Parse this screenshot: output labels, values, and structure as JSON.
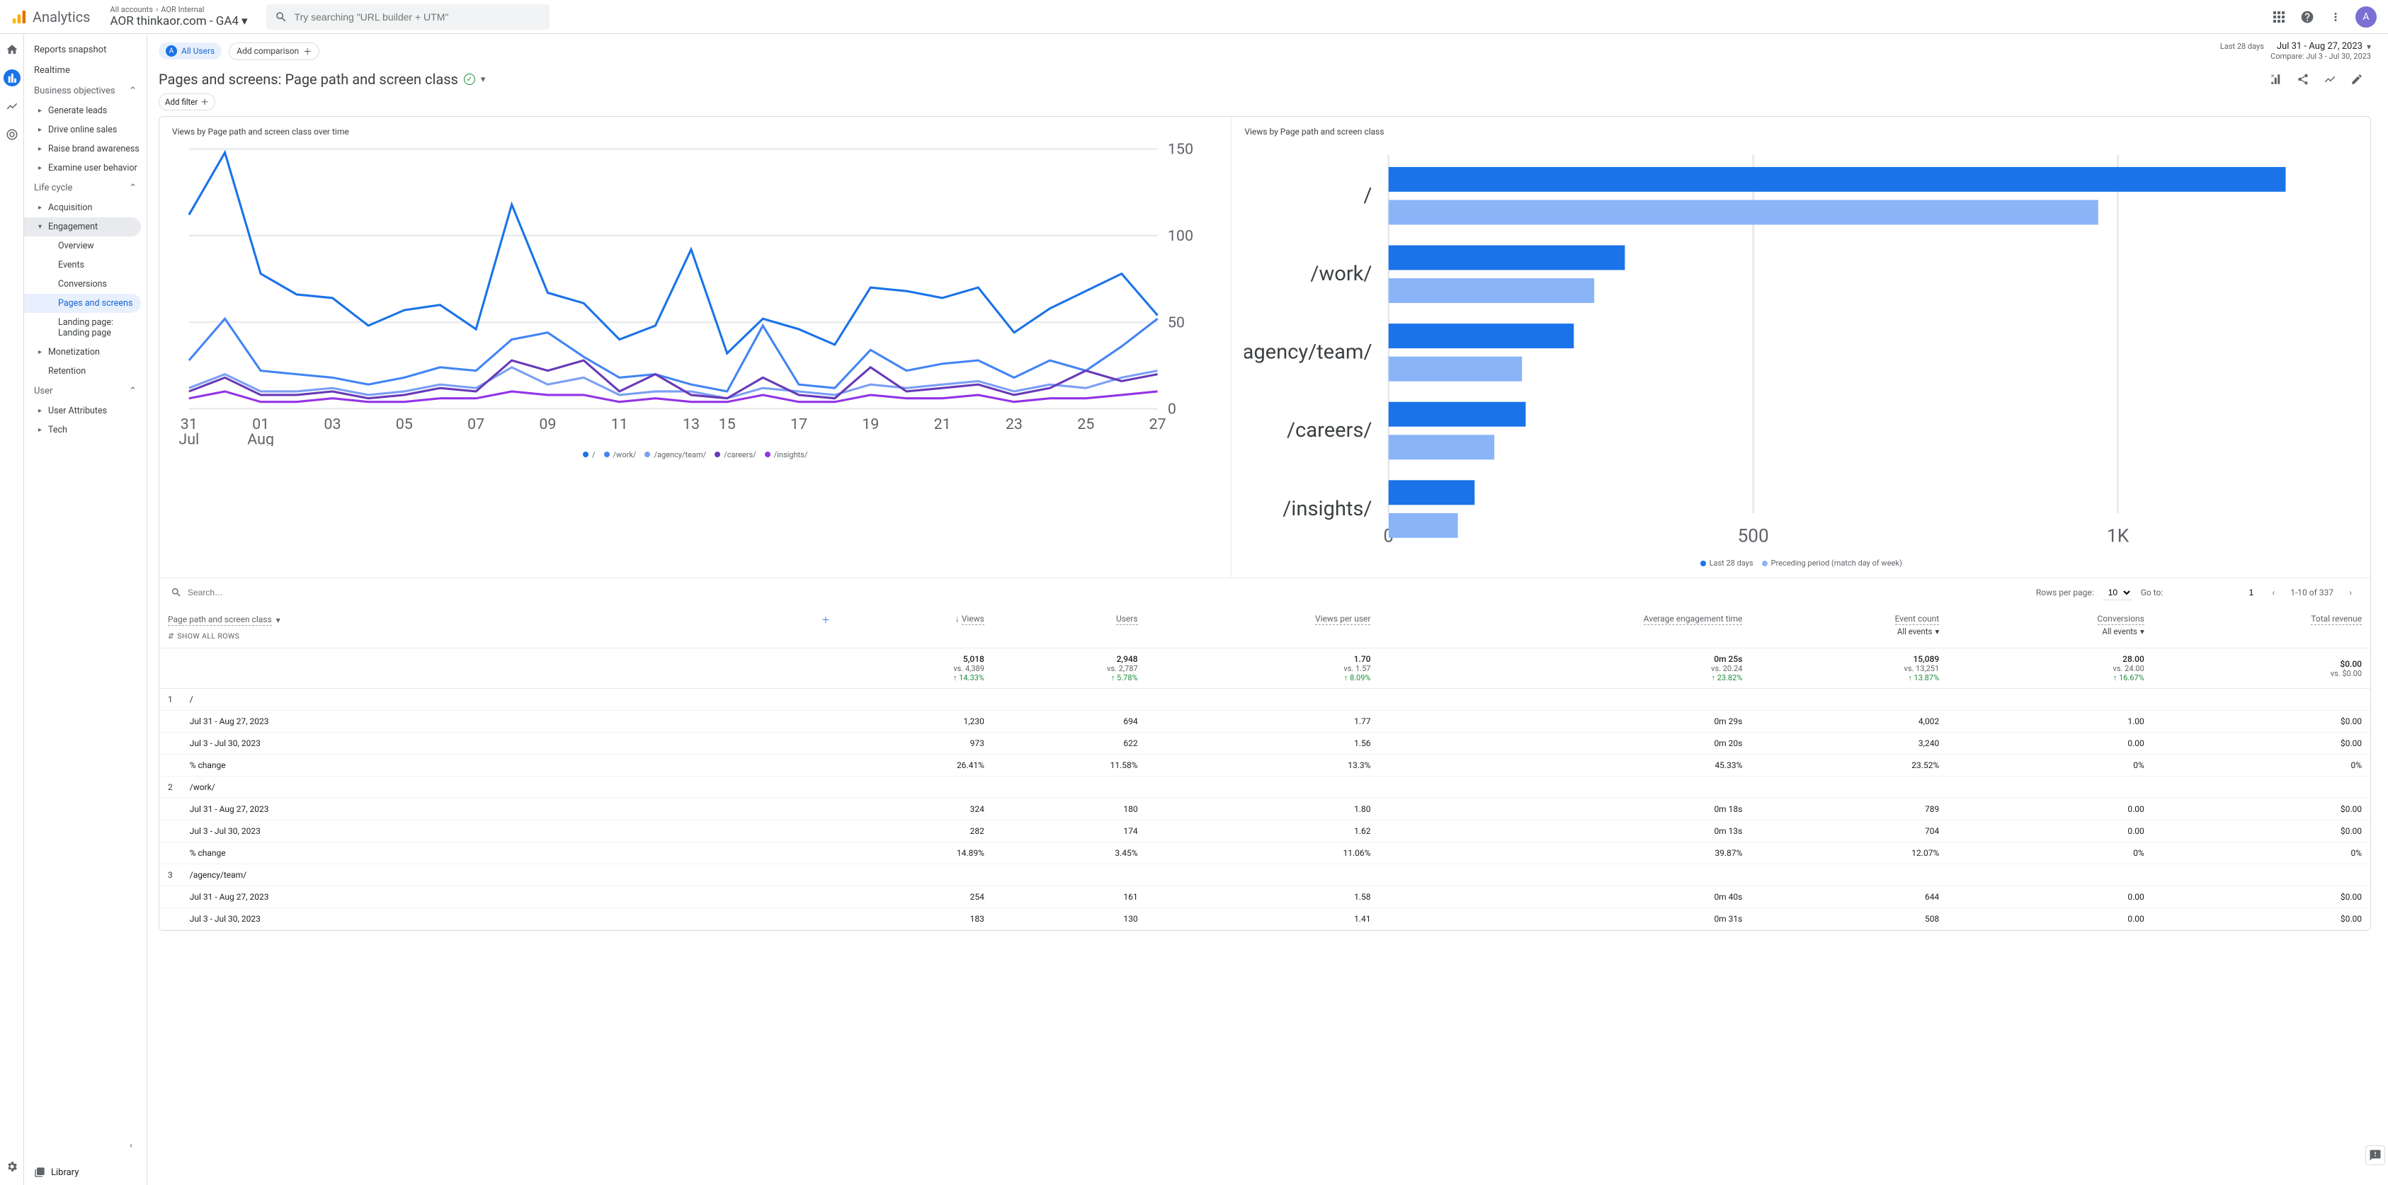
{
  "brand": "Analytics",
  "breadcrumb": {
    "accounts": "All accounts",
    "internal": "AOR Internal",
    "property": "AOR thinkaor.com - GA4"
  },
  "search_placeholder": "Try searching \"URL builder + UTM\"",
  "avatar_letter": "A",
  "sidebar": {
    "reports_snapshot": "Reports snapshot",
    "realtime": "Realtime",
    "business_objectives": "Business objectives",
    "generate_leads": "Generate leads",
    "drive_online_sales": "Drive online sales",
    "raise_brand_awareness": "Raise brand awareness",
    "examine_user_behavior": "Examine user behavior",
    "life_cycle": "Life cycle",
    "acquisition": "Acquisition",
    "engagement": "Engagement",
    "overview": "Overview",
    "events": "Events",
    "conversions": "Conversions",
    "pages_and_screens": "Pages and screens",
    "landing_page": "Landing page: Landing page",
    "monetization": "Monetization",
    "retention": "Retention",
    "user": "User",
    "user_attributes": "User Attributes",
    "tech": "Tech",
    "library": "Library"
  },
  "pills": {
    "all_users": "All Users",
    "add_comparison": "Add comparison"
  },
  "date": {
    "label": "Last 28 days",
    "range": "Jul 31 - Aug 27, 2023",
    "compare": "Compare: Jul 3 - Jul 30, 2023"
  },
  "page_title": "Pages and screens: Page path and screen class",
  "add_filter": "Add filter",
  "chart1_title": "Views by Page path and screen class over time",
  "chart2_title": "Views by Page path and screen class",
  "legend_pages": [
    "/",
    "/work/",
    "/agency/team/",
    "/careers/",
    "/insights/"
  ],
  "legend_colors": [
    "#1a73e8",
    "#4285f4",
    "#7b9ff5",
    "#673ab7",
    "#9334e6"
  ],
  "legend2_a": "Last 28 days",
  "legend2_b": "Preceding period (match day of week)",
  "bar_color_a": "#1a73e8",
  "bar_color_b": "#8ab4f8",
  "chart_data": {
    "line": {
      "type": "line",
      "x_ticks": [
        "31 Jul",
        "01 Aug",
        "03",
        "05",
        "07",
        "09",
        "11",
        "13",
        "15",
        "17",
        "19",
        "21",
        "23",
        "25",
        "27"
      ],
      "ylim": [
        0,
        150
      ],
      "yticks": [
        0,
        50,
        100,
        150
      ],
      "series": [
        {
          "name": "/",
          "color": "#1a73e8",
          "values": [
            112,
            148,
            78,
            66,
            64,
            48,
            57,
            60,
            46,
            118,
            67,
            61,
            40,
            48,
            92,
            32,
            52,
            46,
            37,
            70,
            68,
            64,
            70,
            44,
            58,
            68,
            78,
            54
          ]
        },
        {
          "name": "/work/",
          "color": "#4285f4",
          "values": [
            28,
            52,
            22,
            20,
            18,
            14,
            18,
            24,
            22,
            40,
            44,
            30,
            18,
            20,
            14,
            10,
            48,
            14,
            12,
            34,
            22,
            26,
            28,
            18,
            28,
            22,
            36,
            52
          ]
        },
        {
          "name": "/agency/team/",
          "color": "#7b9ff5",
          "values": [
            12,
            20,
            10,
            10,
            12,
            8,
            10,
            14,
            12,
            24,
            14,
            18,
            8,
            10,
            10,
            6,
            12,
            10,
            8,
            14,
            12,
            14,
            16,
            10,
            14,
            12,
            18,
            22
          ]
        },
        {
          "name": "/careers/",
          "color": "#673ab7",
          "values": [
            10,
            18,
            8,
            8,
            10,
            6,
            8,
            12,
            10,
            28,
            22,
            28,
            10,
            20,
            8,
            6,
            18,
            8,
            6,
            24,
            10,
            12,
            14,
            8,
            12,
            22,
            16,
            20
          ]
        },
        {
          "name": "/insights/",
          "color": "#9334e6",
          "values": [
            6,
            10,
            4,
            4,
            6,
            4,
            4,
            6,
            6,
            10,
            8,
            8,
            4,
            6,
            4,
            4,
            8,
            4,
            4,
            8,
            6,
            6,
            8,
            4,
            6,
            6,
            8,
            10
          ]
        }
      ]
    },
    "bar": {
      "type": "bar",
      "xticks": [
        0,
        500,
        "1K"
      ],
      "xmax": 1300,
      "categories": [
        "/",
        "/work/",
        "/agency/team/",
        "/careers/",
        "/insights/"
      ],
      "series": [
        {
          "name": "Last 28 days",
          "color": "#1a73e8",
          "values": [
            1230,
            324,
            254,
            188,
            118
          ]
        },
        {
          "name": "Preceding period",
          "color": "#8ab4f8",
          "values": [
            973,
            282,
            183,
            145,
            95
          ]
        }
      ]
    }
  },
  "table_search_placeholder": "Search…",
  "pager": {
    "rpp_label": "Rows per page:",
    "rpp_value": "10",
    "goto_label": "Go to:",
    "goto_value": "1",
    "range": "1-10 of 337"
  },
  "table": {
    "dim_header": "Page path and screen class",
    "show_all": "SHOW ALL ROWS",
    "columns": [
      "Views",
      "Users",
      "Views per user",
      "Average engagement time",
      "Event count",
      "Conversions",
      "Total revenue"
    ],
    "sub_all_events": "All events",
    "totals": {
      "values": [
        "5,018",
        "2,948",
        "1.70",
        "0m 25s",
        "15,089",
        "28.00",
        "$0.00"
      ],
      "vs": [
        "vs. 4,389",
        "vs. 2,787",
        "vs. 1.57",
        "vs. 20.24",
        "vs. 13,251",
        "vs. 24.00",
        "vs. $0.00"
      ],
      "delta": [
        "↑ 14.33%",
        "↑ 5.78%",
        "↑ 8.09%",
        "↑ 23.82%",
        "↑ 13.87%",
        "↑ 16.67%",
        ""
      ]
    },
    "range_a": "Jul 31 - Aug 27, 2023",
    "range_b": "Jul 3 - Jul 30, 2023",
    "pct_change": "% change",
    "rows": [
      {
        "idx": "1",
        "path": "/",
        "a": [
          "1,230",
          "694",
          "1.77",
          "0m 29s",
          "4,002",
          "1.00",
          "$0.00"
        ],
        "b": [
          "973",
          "622",
          "1.56",
          "0m 20s",
          "3,240",
          "0.00",
          "$0.00"
        ],
        "d": [
          "26.41%",
          "11.58%",
          "13.3%",
          "45.33%",
          "23.52%",
          "0%",
          "0%"
        ]
      },
      {
        "idx": "2",
        "path": "/work/",
        "a": [
          "324",
          "180",
          "1.80",
          "0m 18s",
          "789",
          "0.00",
          "$0.00"
        ],
        "b": [
          "282",
          "174",
          "1.62",
          "0m 13s",
          "704",
          "0.00",
          "$0.00"
        ],
        "d": [
          "14.89%",
          "3.45%",
          "11.06%",
          "39.87%",
          "12.07%",
          "0%",
          "0%"
        ]
      },
      {
        "idx": "3",
        "path": "/agency/team/",
        "a": [
          "254",
          "161",
          "1.58",
          "0m 40s",
          "644",
          "0.00",
          "$0.00"
        ],
        "b": [
          "183",
          "130",
          "1.41",
          "0m 31s",
          "508",
          "0.00",
          "$0.00"
        ]
      }
    ]
  }
}
